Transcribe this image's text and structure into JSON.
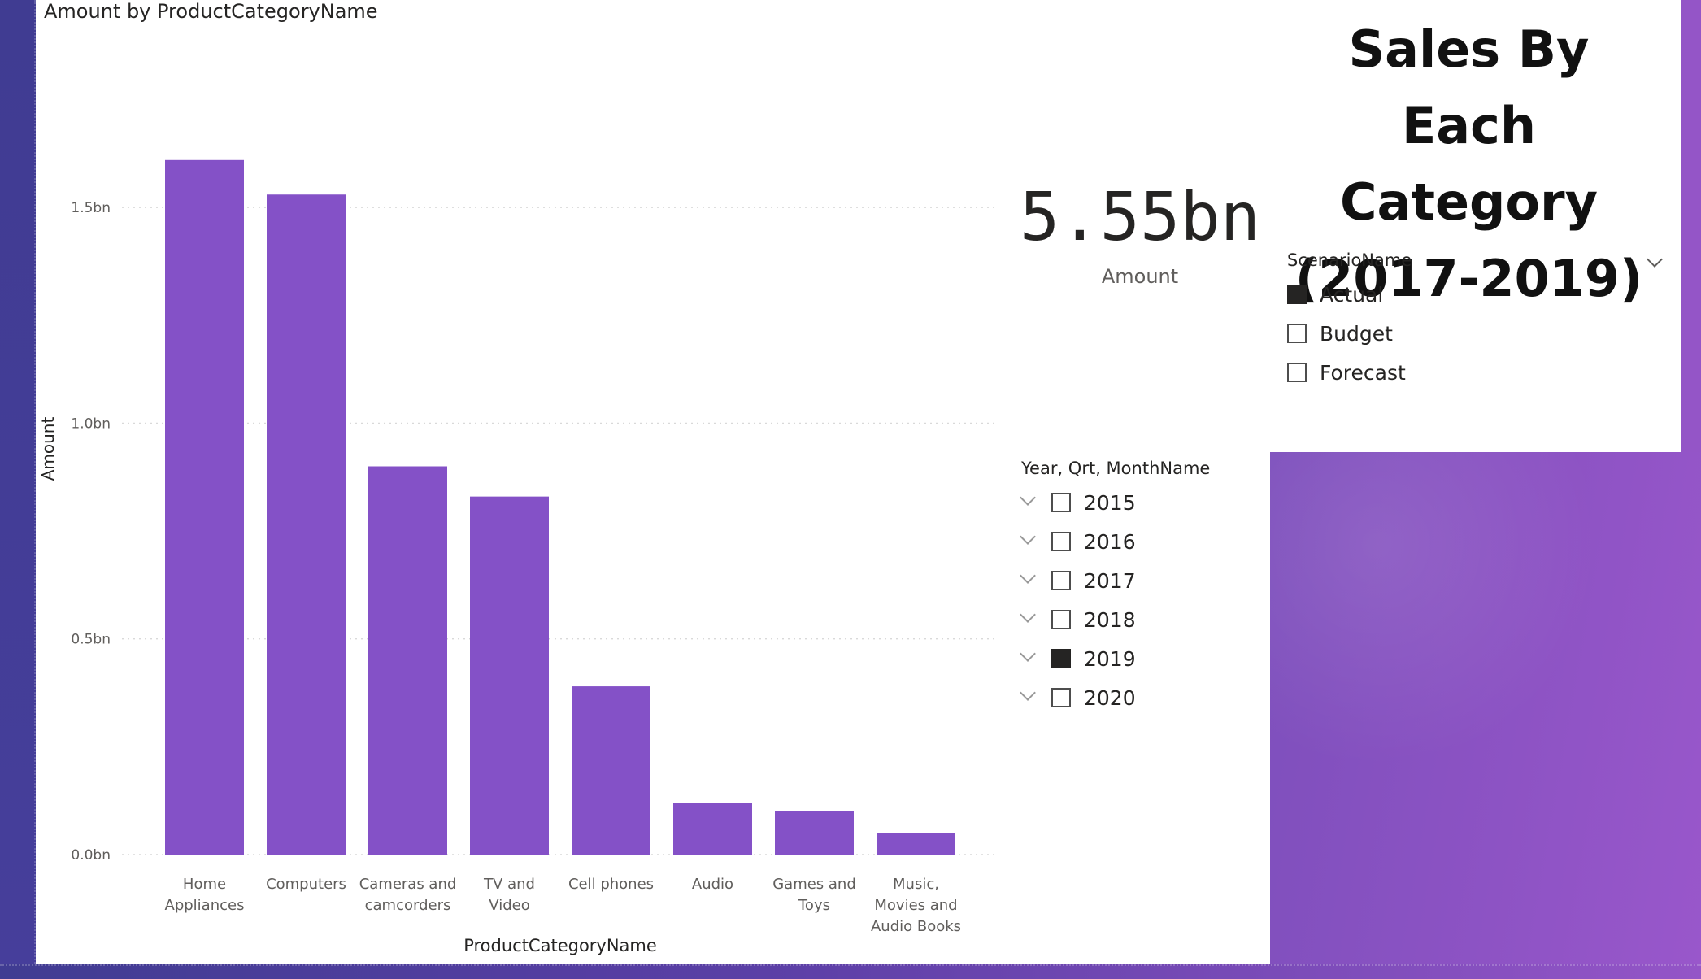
{
  "dashboard": {
    "title": "Sales By Each Category (2017-2019)"
  },
  "card": {
    "value": "5.55bn",
    "label": "Amount"
  },
  "scenario_slicer": {
    "header": "ScenarioName",
    "options": [
      {
        "label": "Actual",
        "checked": true
      },
      {
        "label": "Budget",
        "checked": false
      },
      {
        "label": "Forecast",
        "checked": false
      }
    ]
  },
  "year_slicer": {
    "header": "Year, Qrt, MonthName",
    "options": [
      {
        "label": "2015",
        "checked": false
      },
      {
        "label": "2016",
        "checked": false
      },
      {
        "label": "2017",
        "checked": false
      },
      {
        "label": "2018",
        "checked": false
      },
      {
        "label": "2019",
        "checked": true
      },
      {
        "label": "2020",
        "checked": false
      }
    ]
  },
  "chart_data": {
    "type": "bar",
    "title": "Amount by ProductCategoryName",
    "xlabel": "ProductCategoryName",
    "ylabel": "Amount",
    "categories": [
      "Home Appliances",
      "Computers",
      "Cameras and camcorders",
      "TV and Video",
      "Cell phones",
      "Audio",
      "Games and Toys",
      "Music, Movies and Audio Books"
    ],
    "category_lines": [
      [
        "Home",
        "Appliances"
      ],
      [
        "Computers"
      ],
      [
        "Cameras and",
        "camcorders"
      ],
      [
        "TV and",
        "Video"
      ],
      [
        "Cell phones"
      ],
      [
        "Audio"
      ],
      [
        "Games and",
        "Toys"
      ],
      [
        "Music,",
        "Movies and",
        "Audio Books"
      ]
    ],
    "values": [
      1.61,
      1.53,
      0.9,
      0.83,
      0.39,
      0.12,
      0.1,
      0.05
    ],
    "value_unit": "bn",
    "ylim": [
      0,
      1.8
    ],
    "ytick_values": [
      0,
      0.5,
      1.0,
      1.5
    ],
    "yticks": [
      "0.0bn",
      "0.5bn",
      "1.0bn",
      "1.5bn"
    ],
    "grid": true,
    "colors": {
      "bar": "#8451c7",
      "grid": "#d9d9d9",
      "text": "#605e5c",
      "axis_title": "#252423"
    }
  }
}
